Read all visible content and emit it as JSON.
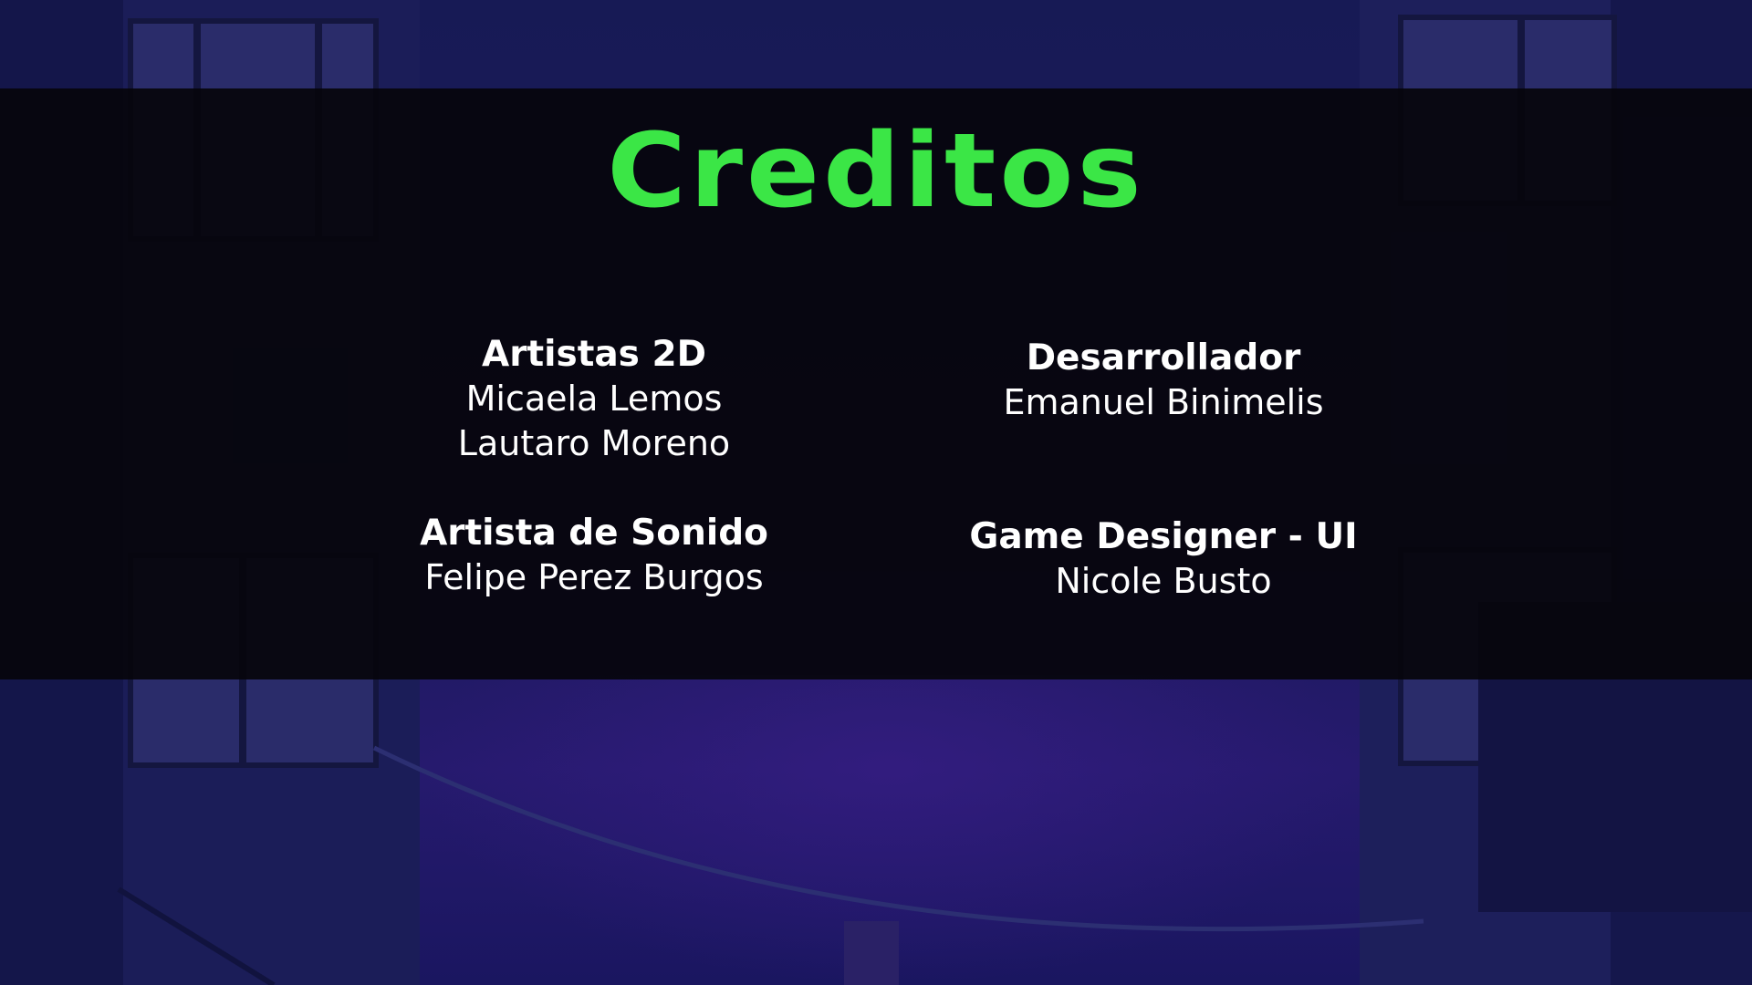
{
  "screen": {
    "title": "Creditos",
    "colors": {
      "title": "#3be646",
      "text": "#ffffff",
      "panel": "#06050c",
      "background": "#171a55"
    }
  },
  "credits": {
    "artists_2d": {
      "role": "Artistas 2D",
      "names": [
        "Micaela Lemos",
        "Lautaro Moreno"
      ]
    },
    "sound_artist": {
      "role": "Artista de Sonido",
      "names": [
        "Felipe Perez Burgos"
      ]
    },
    "developer": {
      "role": "Desarrollador",
      "names": [
        "Emanuel Binimelis"
      ]
    },
    "game_designer": {
      "role": "Game Designer - UI",
      "names": [
        "Nicole Busto"
      ]
    }
  }
}
